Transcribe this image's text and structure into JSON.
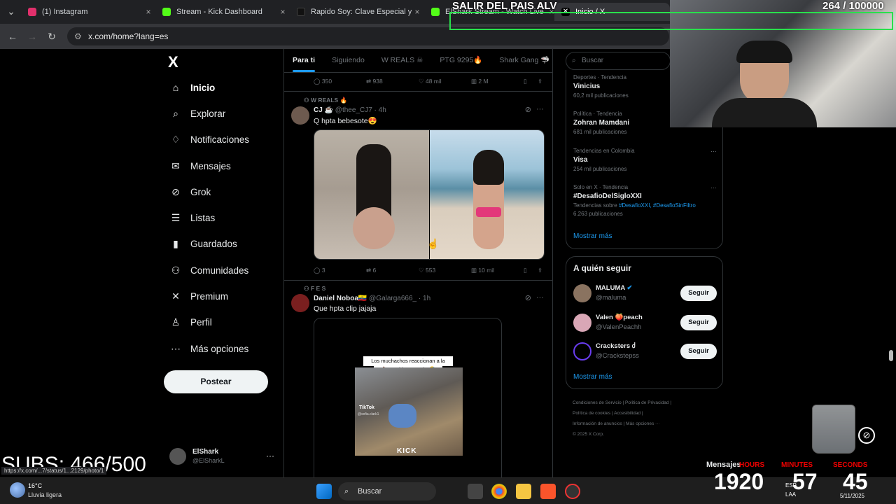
{
  "browser": {
    "tabs": [
      {
        "label": "(1) Instagram",
        "color": "#e1306c"
      },
      {
        "label": "Stream - Kick Dashboard",
        "color": "#53fc18"
      },
      {
        "label": "Rapido Soy: Clave Especial y Co",
        "color": "#000000"
      },
      {
        "label": "ElShark Stream - Watch Live on",
        "color": "#53fc18"
      },
      {
        "label": "Inicio / X",
        "color": "#000000"
      }
    ],
    "url": "x.com/home?lang=es"
  },
  "nav": {
    "logo": "X",
    "items": [
      {
        "label": "Inicio",
        "icon": "home-icon",
        "glyph": "⌂"
      },
      {
        "label": "Explorar",
        "icon": "search-icon",
        "glyph": "⌕"
      },
      {
        "label": "Notificaciones",
        "icon": "bell-icon",
        "glyph": "♢"
      },
      {
        "label": "Mensajes",
        "icon": "mail-icon",
        "glyph": "✉"
      },
      {
        "label": "Grok",
        "icon": "grok-icon",
        "glyph": "⊘"
      },
      {
        "label": "Listas",
        "icon": "list-icon",
        "glyph": "☰"
      },
      {
        "label": "Guardados",
        "icon": "bookmark-icon",
        "glyph": "▮"
      },
      {
        "label": "Comunidades",
        "icon": "people-icon",
        "glyph": "⚇"
      },
      {
        "label": "Premium",
        "icon": "x-icon",
        "glyph": "✕"
      },
      {
        "label": "Perfil",
        "icon": "person-icon",
        "glyph": "♙"
      },
      {
        "label": "Más opciones",
        "icon": "more-circle-icon",
        "glyph": "⋯"
      }
    ],
    "post_button": "Postear",
    "account": {
      "name": "ElShark",
      "handle": "@ElSharkL"
    }
  },
  "feed": {
    "tabs": [
      "Para ti",
      "Siguiendo",
      "W REALS ☠",
      "PTG 9295🔥",
      "Shark Gang 🦈"
    ],
    "top_actions": {
      "replies": "350",
      "reposts": "938",
      "likes": "48 mil",
      "views": "2 M"
    },
    "posts": [
      {
        "context": "W REALS 🔥",
        "name": "CJ ☕",
        "handle": "@thee_CJ7",
        "time": "4h",
        "text": "Q hpta bebesote😍",
        "actions": {
          "replies": "3",
          "reposts": "6",
          "likes": "553",
          "views": "10 mil"
        }
      },
      {
        "context": "F E S",
        "name": "Daniel Noboa🇪🇨",
        "handle": "@Galarga666_",
        "time": "1h",
        "text": "Que hpta clip jajaja",
        "video_caption_line1": "Los muchachos reaccionan a la",
        "video_caption_line2": "💩 que hizo Maggie 🤣",
        "video_watermark": "TikTok",
        "video_watermark_handle": "@sofia.clark1",
        "video_logo": "KICK"
      }
    ]
  },
  "right": {
    "search_placeholder": "Buscar",
    "trends": [
      {
        "meta": "Deportes · Tendencia",
        "name": "Vinicius",
        "count": "60,2 mil publicaciones"
      },
      {
        "meta": "Política · Tendencia",
        "name": "Zohran Mamdani",
        "count": "681 mil publicaciones"
      },
      {
        "meta": "Tendencias en Colombia",
        "name": "Visa",
        "count": "254 mil publicaciones"
      },
      {
        "meta": "Solo en X · Tendencia",
        "name": "#DesafioDelSigloXXI",
        "sub": "Tendencias sobre",
        "sub_links": "#DesafioXXI, #DesafioSinFiltro",
        "count": "6.263 publicaciones"
      }
    ],
    "show_more": "Mostrar más",
    "who_to_follow_title": "A quién seguir",
    "who_to_follow": [
      {
        "name": "MALUMA",
        "handle": "@maluma",
        "button": "Seguir"
      },
      {
        "name": "Valen 🍑peach",
        "handle": "@ValenPeachh",
        "button": "Seguir"
      },
      {
        "name": "Cracksters ძ",
        "handle": "@Crackstерss",
        "button": "Seguir"
      }
    ],
    "show_more_2": "Mostrar más",
    "footer": [
      "Condiciones de Servicio | Política de Privacidad |",
      "Política de cookies | Accesibilidad |",
      "Información de anuncios | Más opciones ···",
      "© 2025 X Corp."
    ]
  },
  "overlay": {
    "title": "SALIR DEL PAIS ALV",
    "counter": "264  / 100000",
    "subs": "SUBS: 466/500",
    "timer": {
      "hours": "1920",
      "minutes": "57",
      "seconds": "45",
      "hours_label": "HOURS",
      "minutes_label": "MINUTES",
      "seconds_label": "SECONDS"
    },
    "messages_label": "Mensajes"
  },
  "status_link": "https://x.com/...7/status/1...2129/photo/1",
  "taskbar": {
    "weather_temp": "16°C",
    "weather_desc": "Lluvia ligera",
    "search": "Buscar",
    "lang": "ESP",
    "lang2": "LAA",
    "date": "5/11/2025"
  }
}
